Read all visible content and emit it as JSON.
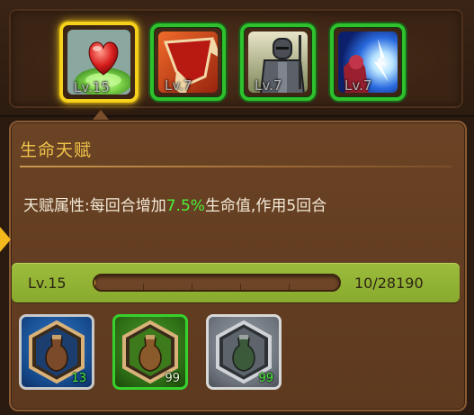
{
  "skills": [
    {
      "name": "life-talent",
      "level_label": "Lv.15",
      "selected": true
    },
    {
      "name": "rage-talent",
      "level_label": "Lv.7",
      "selected": false
    },
    {
      "name": "guard-talent",
      "level_label": "Lv.7",
      "selected": false
    },
    {
      "name": "strike-talent",
      "level_label": "Lv.7",
      "selected": false
    }
  ],
  "panel": {
    "title": "生命天赋",
    "desc_prefix": "天赋属性:每回合增加",
    "desc_highlight": "7.5%",
    "desc_suffix": "生命值,作用5回合"
  },
  "level": {
    "label": "Lv.15",
    "current": 10,
    "max": 28190,
    "progress_text": "10/28190"
  },
  "items": [
    {
      "icon": "potion-icon",
      "count": "13",
      "frame": "blue"
    },
    {
      "icon": "potion-icon",
      "count": "99",
      "frame": "green"
    },
    {
      "icon": "potion-icon",
      "count": "99",
      "frame": "gray"
    }
  ],
  "colors": {
    "highlight": "#4cf03a",
    "title": "#f0c54a",
    "selected_frame": "#f6d21a",
    "normal_frame": "#2fc12d",
    "level_bar": "#9cbc3b"
  }
}
